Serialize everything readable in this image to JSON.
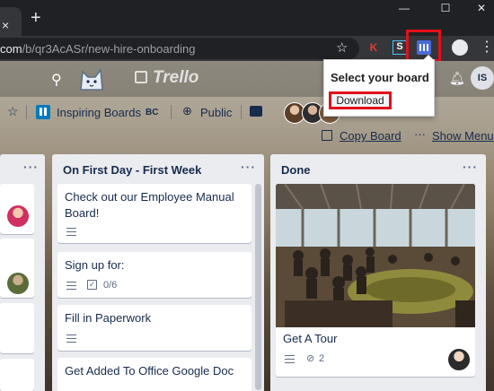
{
  "browser": {
    "tab_close": "×",
    "new_tab": "+",
    "window_controls": {
      "minimize": "—",
      "maximize": "☐",
      "close": "✕"
    },
    "url_host": "com",
    "url_path": "/b/qr3AcASr/new-hire-onboarding",
    "bookmark_icon": "star-icon",
    "extensions": [
      {
        "name": "k-extension-icon",
        "label": "K",
        "color": "#e53935"
      },
      {
        "name": "s-extension-icon",
        "label": "S",
        "color": "#4fc3f7"
      },
      {
        "name": "board-export-extension-icon",
        "label": "",
        "color": "#4a6bd8"
      }
    ],
    "menu": "⋮",
    "highlight_color": "#e3101b"
  },
  "popup": {
    "title": "Select your board",
    "download_label": "Download"
  },
  "trello": {
    "logo_text": "Trello",
    "user_initials": "IS",
    "board_bar": {
      "team_name": "Inspiring Boards",
      "team_badge": "BC",
      "visibility": "Public",
      "copy_board": "Copy Board",
      "more": "···",
      "show_menu": "Show Menu"
    },
    "lists": [
      {
        "title": "",
        "menu": "···",
        "cards": []
      },
      {
        "title": "On First Day - First Week",
        "menu": "···",
        "cards": [
          {
            "title_line1": "Check out our Employee Manual",
            "title_line2": "Board!"
          },
          {
            "title": "Sign up for:",
            "checklist": "0/6"
          },
          {
            "title": "Fill in Paperwork"
          },
          {
            "title": "Get Added To Office Google Doc"
          }
        ]
      },
      {
        "title": "Done",
        "menu": "···",
        "cards": [
          {
            "title": "Get A Tour",
            "attachments": "2"
          }
        ]
      }
    ]
  }
}
